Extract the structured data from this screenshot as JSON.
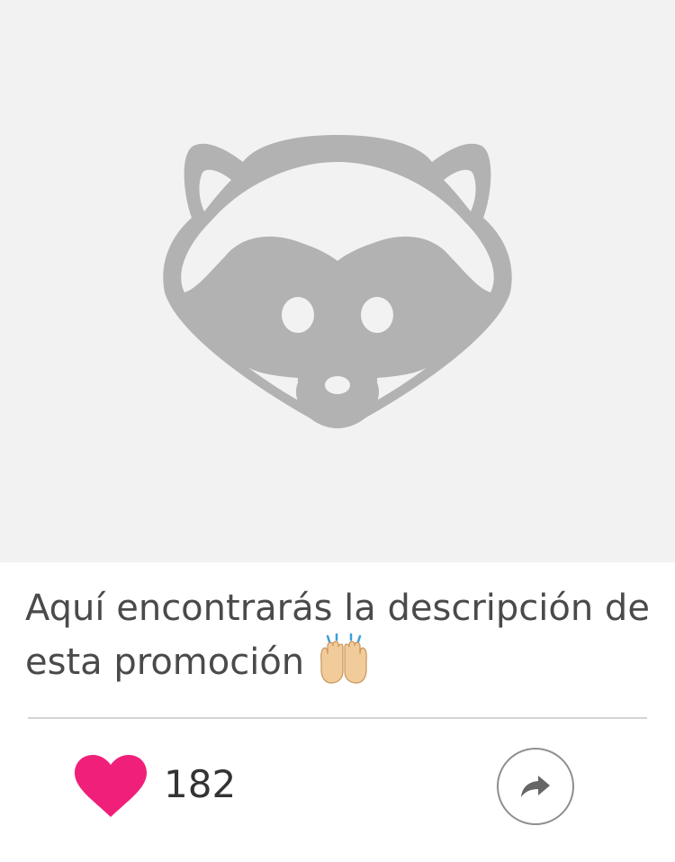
{
  "promo": {
    "placeholder_icon": "raccoon-icon",
    "description": "Aquí encontrarás la descripción de esta promoción",
    "description_emoji": "🙌"
  },
  "actions": {
    "like_icon": "heart-icon",
    "like_count": "182",
    "share_icon": "share-arrow-icon"
  },
  "colors": {
    "image_background": "#f2f2f2",
    "placeholder_gray": "#b3b2b3",
    "heart": "#f0207a",
    "text": "#4a4a4a",
    "divider": "#d4d4d4"
  }
}
